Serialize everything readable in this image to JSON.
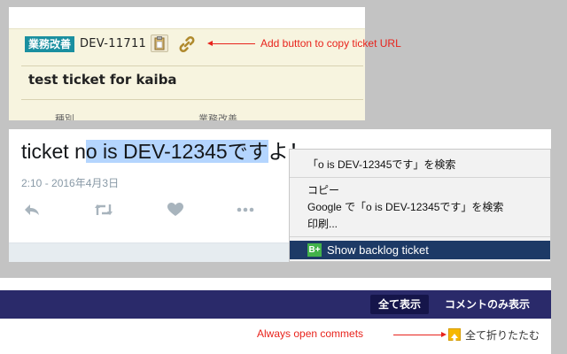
{
  "ticket": {
    "issue_type": "業務改善",
    "key": "DEV-11711",
    "title": "test ticket for kaiba",
    "field_labels": [
      "種別",
      "業務改善"
    ]
  },
  "annotations": {
    "copy_url": "Add button to copy ticket URL",
    "always_open": "Always open commets"
  },
  "tweet": {
    "text_before": "ticket n",
    "text_selected": "o is DEV-12345です",
    "text_after": "よ！",
    "timestamp": "2:10 - 2016年4月3日",
    "actions": [
      "reply-icon",
      "retweet-icon",
      "like-icon",
      "more-icon"
    ]
  },
  "context_menu": {
    "search_item": "「o is DEV-12345です」を検索",
    "copy_item": "コピー",
    "google_search_item": "Google で「o is DEV-12345です」を検索",
    "print_item": "印刷...",
    "extension_icon": "B+",
    "extension_item": "Show backlog ticket"
  },
  "comments_bar": {
    "show_all": "全て表示",
    "comments_only": "コメントのみ表示",
    "collapse_all": "全て折りたたむ"
  },
  "colors": {
    "annotation": "#e8231c",
    "issue_type_badge": "#1a8fa0",
    "selection": "#b4d5fe",
    "menu_highlight": "#1d3a66",
    "navbar": "#2a2a6a",
    "backlog_green": "#42b24a"
  }
}
